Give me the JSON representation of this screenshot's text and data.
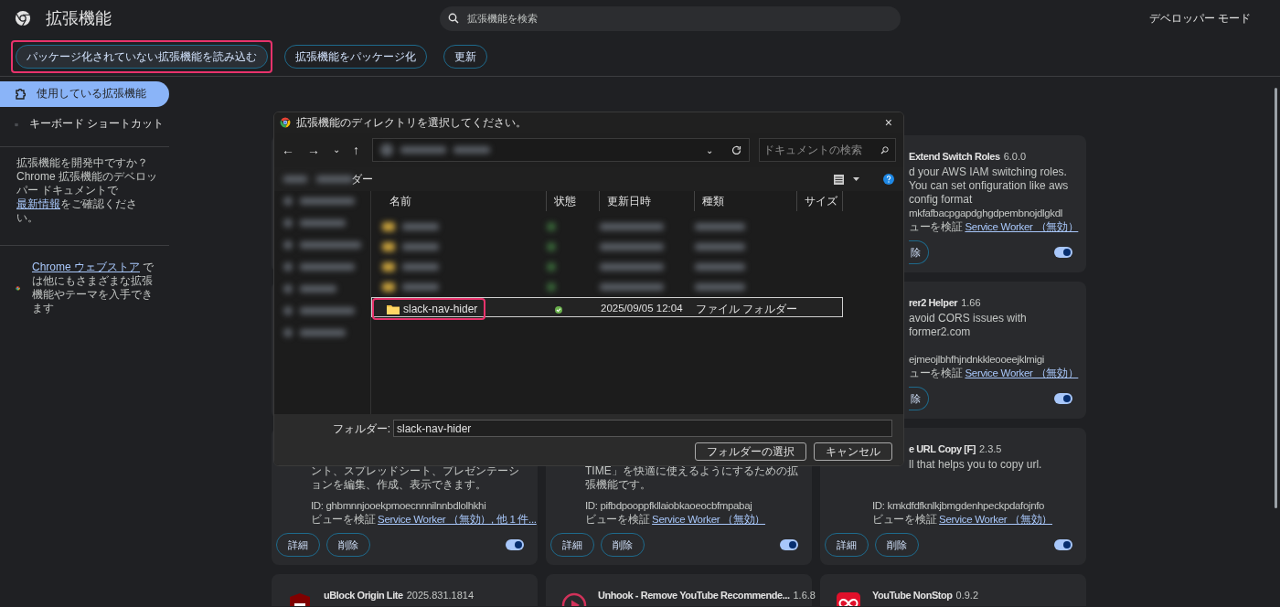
{
  "header": {
    "title": "拡張機能",
    "search": {
      "placeholder": "拡張機能を検索"
    },
    "developer_mode": {
      "label": "デベロッパー モード"
    }
  },
  "toolbar": [
    {
      "label": "パッケージ化されていない拡張機能を読み込む",
      "highlighted": true
    },
    {
      "label": "拡張機能をパッケージ化",
      "highlighted": false
    },
    {
      "label": "更新",
      "highlighted": false
    }
  ],
  "sidebar": {
    "items": [
      {
        "label": "使用している拡張機能",
        "selected": true,
        "kind": "puzzle"
      },
      {
        "label": "キーボード ショートカット",
        "selected": false,
        "kind": "keyboard"
      }
    ],
    "dev_note": {
      "text": "拡張機能を開発中ですか？ Chrome 拡張機能のデベロッパー ドキュメントで",
      "link": "最新情報",
      "after": "をご確認ください。"
    },
    "store_note": {
      "link": "Chrome ウェブストア",
      "text": " では他にもさまざまな拡張機能やテーマを入手できます"
    }
  },
  "cards": [
    {
      "name": "Extend Switch Roles",
      "version": "6.0.0",
      "description": "d your AWS IAM switching roles. You can set onfiguration like aws config format",
      "id": "mkfafbacpgapdghgdpembnojdlgkdl",
      "inspect": "ューを検証",
      "inspect_link": "Service Worker （無効）",
      "buttons": [
        "除"
      ],
      "enabled": true
    },
    {
      "name": "rer2 Helper",
      "version": "1.66",
      "description": "avoid CORS issues with former2.com",
      "id": "ejmeojlbhfhjndnkkleooeejklmigi",
      "inspect": "ューを検証",
      "inspect_link": "Service Worker （無効）",
      "buttons": [
        "除"
      ],
      "enabled": true
    },
    {
      "description": "ント、スプレッドシート、プレゼンテーションを編集、作成、表示できます。",
      "id": "ID: ghbmnnjooekpmoecnnnilnnbdlolhkhi",
      "inspect": "ビューを検証",
      "inspect_link": "Service Worker （無効）, 他 1 件...",
      "buttons": [
        "詳細",
        "削除"
      ],
      "enabled": true
    },
    {
      "description": "TIME」を快適に使えるようにするための拡張機能です。",
      "id": "ID: pifbdpooppfkllaiobkaoeocbfmpabaj",
      "inspect": "ビューを検証",
      "inspect_link": "Service Worker （無効）",
      "buttons": [
        "詳細",
        "削除"
      ],
      "enabled": true
    },
    {
      "name": "e URL Copy [F]",
      "version": "2.3.5",
      "description": "ll that helps you to copy url.",
      "id": "ID: kmkdfdfknlkjbmgdenhpeckpdafojnfo",
      "inspect": "ビューを検証",
      "inspect_link": "Service Worker （無効）",
      "buttons": [
        "詳細",
        "削除"
      ],
      "enabled": true
    },
    {
      "name": "uBlock Origin Lite",
      "version": "2025.831.1814",
      "kind": "shield"
    },
    {
      "name": "Unhook - Remove YouTube Recommende...",
      "version": "1.6.8",
      "kind": "play"
    },
    {
      "name": "YouTube NonStop",
      "version": "0.9.2",
      "kind": "infinity"
    }
  ],
  "dialog": {
    "title": "拡張機能のディレクトリを選択してください。",
    "close": "×",
    "nav_buttons": [
      "←",
      "→",
      "⌄",
      "↑"
    ],
    "address_dropdown": "⌄",
    "search": {
      "placeholder": "ドキュメントの検索"
    },
    "command_bar_text": "ダー",
    "columns": [
      "名前",
      "状態",
      "更新日時",
      "種類",
      "サイズ"
    ],
    "files": [
      {
        "name": "slack-nav-hider",
        "modified": "2025/09/05 12:04",
        "type": "ファイル フォルダー",
        "selected": true,
        "highlighted": true
      }
    ],
    "folder_field": {
      "label": "フォルダー:",
      "value": "slack-nav-hider"
    },
    "buttons": [
      "フォルダーの選択",
      "キャンセル"
    ]
  }
}
